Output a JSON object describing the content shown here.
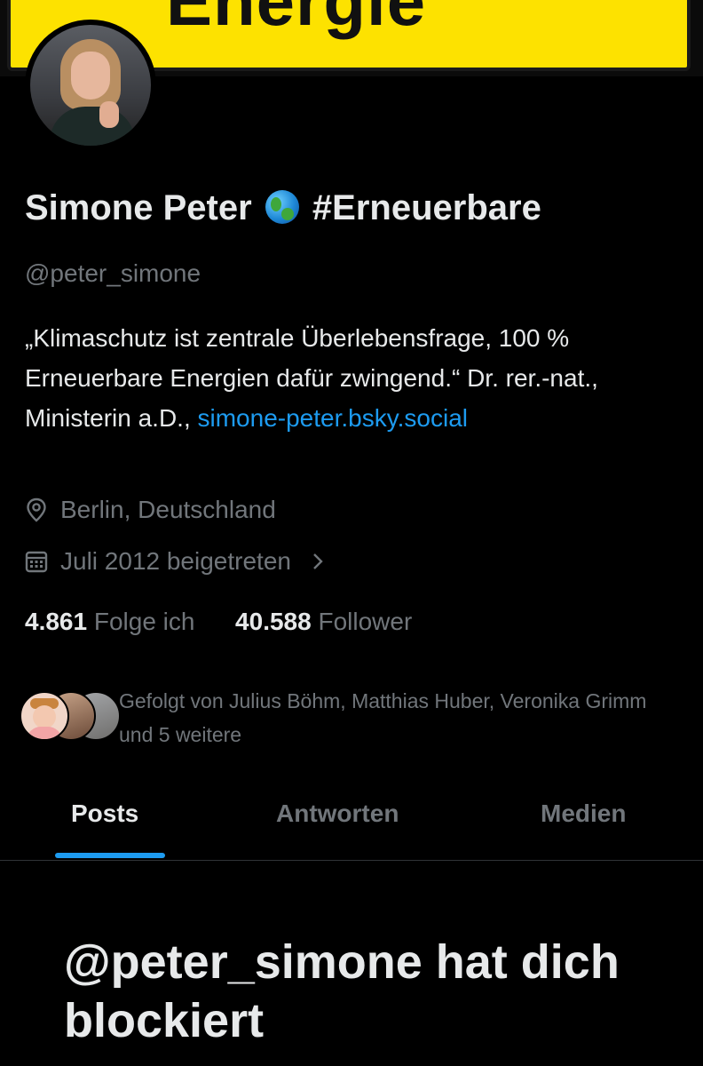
{
  "banner": {
    "sign_text": "Energie"
  },
  "profile": {
    "name": "Simone Peter",
    "hashtag": "#Erneuerbare",
    "handle": "@peter_simone",
    "bio_text": "„Klimaschutz ist zentrale Überlebensfrage, 100 % Erneuerbare Energien dafür zwingend.“ Dr. rer.-nat., Ministerin a.D.,",
    "bio_link": "simone-peter.bsky.social",
    "location": "Berlin, Deutschland",
    "joined": "Juli 2012 beigetreten"
  },
  "stats": {
    "following_count": "4.861",
    "following_label": "Folge ich",
    "followers_count": "40.588",
    "followers_label": "Follower"
  },
  "followed_by": "Gefolgt von Julius Böhm, Matthias Huber, Veronika Grimm und 5 weitere",
  "tabs": [
    {
      "label": "Posts",
      "active": true
    },
    {
      "label": "Antworten"
    },
    {
      "label": "Medien"
    }
  ],
  "blocked_message": "@peter_simone hat dich blockiert",
  "colors": {
    "accent": "#1d9bf0",
    "muted": "#71767b",
    "text": "#e7e9ea",
    "banner_yellow": "#fde200"
  }
}
